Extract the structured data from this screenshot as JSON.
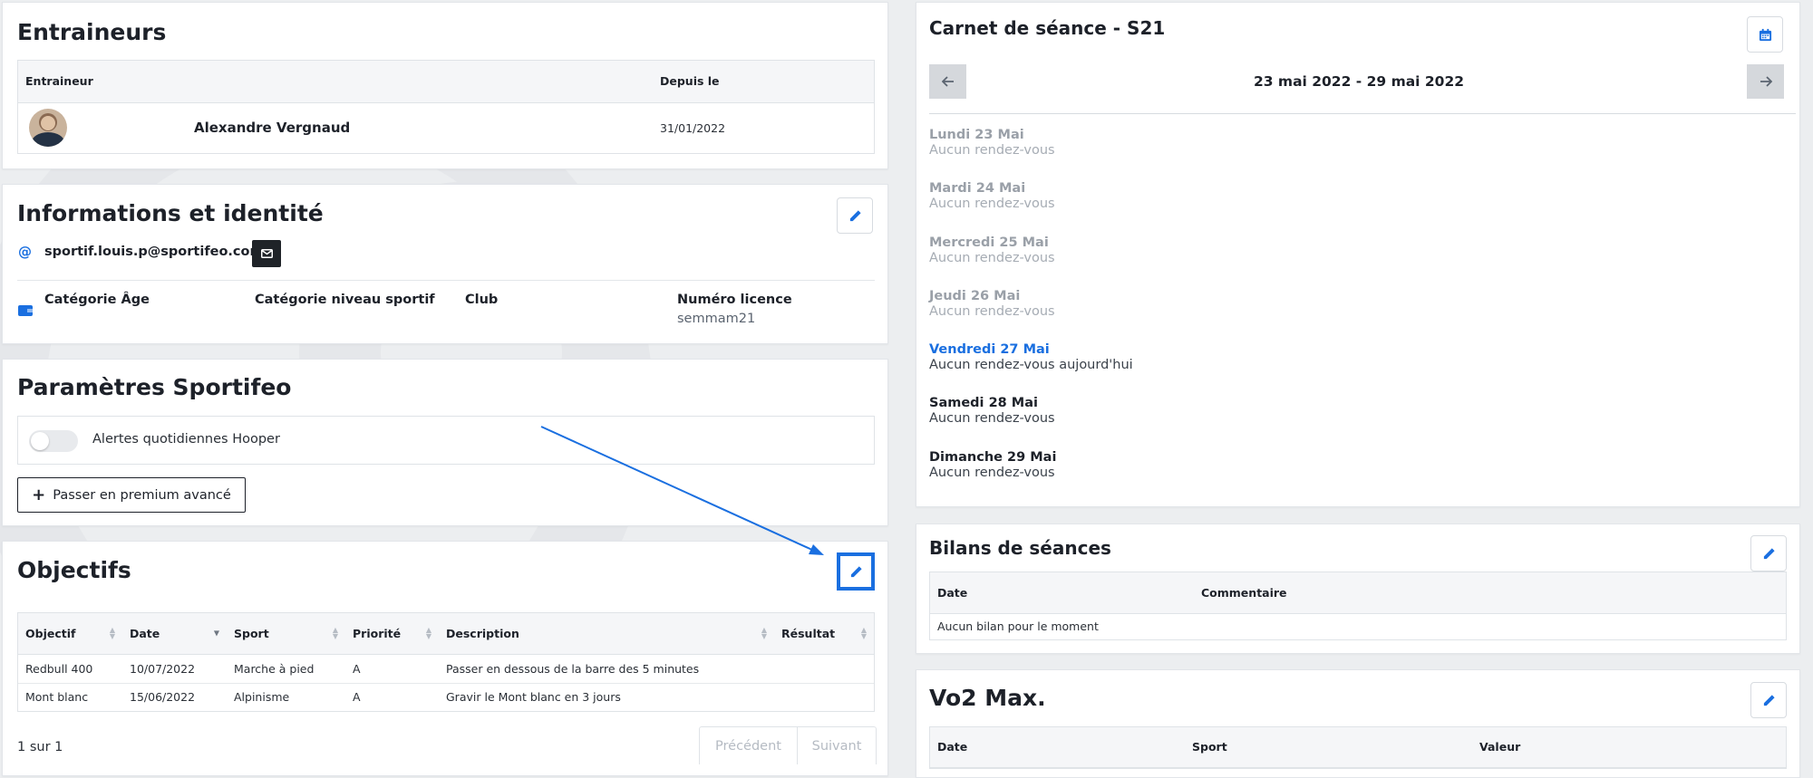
{
  "trainers": {
    "title": "Entraineurs",
    "columns": [
      "Entraineur",
      "Depuis le"
    ],
    "rows": [
      {
        "name": "Alexandre Vergnaud",
        "since": "31/01/2022"
      }
    ]
  },
  "identity": {
    "title": "Informations et identité",
    "email": "sportif.louis.p@sportifeo.com",
    "fields": [
      {
        "label": "Catégorie Âge",
        "value": ""
      },
      {
        "label": "Catégorie niveau sportif",
        "value": ""
      },
      {
        "label": "Club",
        "value": ""
      },
      {
        "label": "Numéro licence",
        "value": "semmam21"
      }
    ]
  },
  "settings": {
    "title": "Paramètres Sportifeo",
    "toggle_label": "Alertes quotidiennes Hooper",
    "toggle_on": false,
    "premium_button": "Passer en premium avancé"
  },
  "objectives": {
    "title": "Objectifs",
    "columns": [
      "Objectif",
      "Date",
      "Sport",
      "Priorité",
      "Description",
      "Résultat"
    ],
    "rows": [
      [
        "Redbull 400",
        "10/07/2022",
        "Marche à pied",
        "A",
        "Passer en dessous de la barre des 5 minutes",
        ""
      ],
      [
        "Mont blanc",
        "15/06/2022",
        "Alpinisme",
        "A",
        "Gravir le Mont blanc en 3 jours",
        ""
      ]
    ],
    "pagination_info": "1 sur 1",
    "prev": "Précédent",
    "next": "Suivant"
  },
  "calendar": {
    "title": "Carnet de séance - S21",
    "range": "23 mai 2022 - 29 mai 2022",
    "days": [
      {
        "name": "Lundi 23 Mai",
        "note": "Aucun rendez-vous",
        "state": "past"
      },
      {
        "name": "Mardi 24 Mai",
        "note": "Aucun rendez-vous",
        "state": "past"
      },
      {
        "name": "Mercredi 25 Mai",
        "note": "Aucun rendez-vous",
        "state": "past"
      },
      {
        "name": "Jeudi 26 Mai",
        "note": "Aucun rendez-vous",
        "state": "past"
      },
      {
        "name": "Vendredi 27 Mai",
        "note": "Aucun rendez-vous aujourd'hui",
        "state": "today"
      },
      {
        "name": "Samedi 28 Mai",
        "note": "Aucun rendez-vous",
        "state": "future"
      },
      {
        "name": "Dimanche 29 Mai",
        "note": "Aucun rendez-vous",
        "state": "future"
      }
    ]
  },
  "reviews": {
    "title": "Bilans de séances",
    "columns": [
      "Date",
      "Commentaire"
    ],
    "empty": "Aucun bilan pour le moment"
  },
  "vo2": {
    "title": "Vo2 Max.",
    "columns": [
      "Date",
      "Sport",
      "Valeur"
    ]
  },
  "colors": {
    "accent": "#1a6fe0",
    "past_text": "#9aa0a8",
    "highlight_border": "#1a6fe0"
  }
}
